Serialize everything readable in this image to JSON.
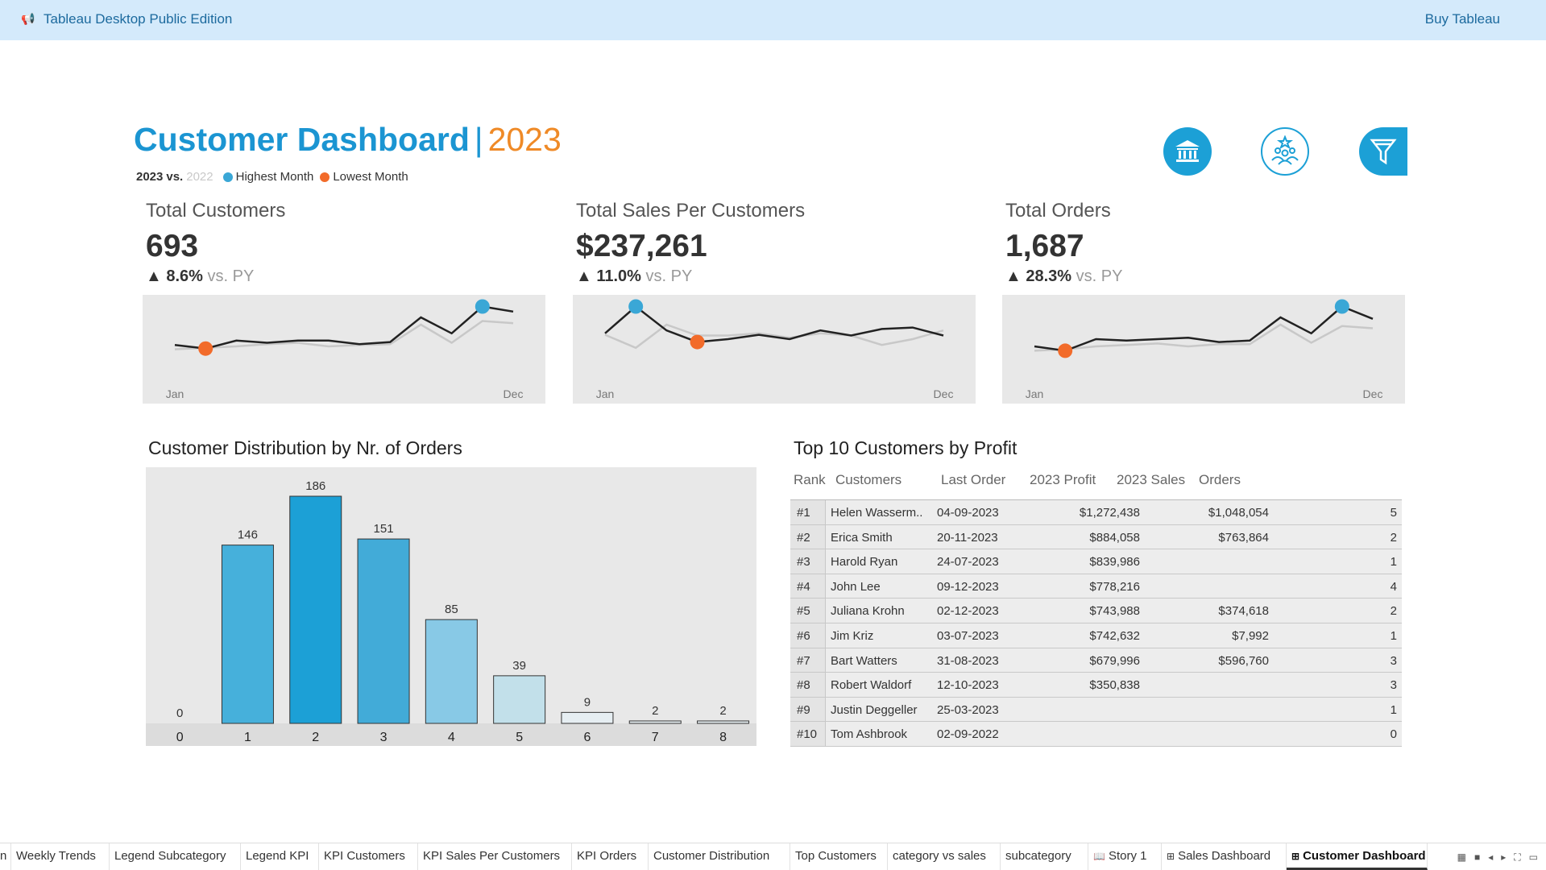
{
  "topbar": {
    "pin_icon": "megaphone-icon",
    "app_title": "Tableau Desktop Public Edition",
    "buy_label": "Buy Tableau"
  },
  "header": {
    "title": "Customer Dashboard",
    "separator": "|",
    "year": "2023",
    "legend": {
      "current": "2023",
      "vs": "vs.",
      "previous": "2022",
      "highest": "Highest Month",
      "lowest": "Lowest Month"
    }
  },
  "colors": {
    "accent": "#1b95d2",
    "year": "#ef8a27",
    "highest": "#3aa7d6",
    "lowest": "#f26b2a",
    "line_current": "#222222",
    "line_previous": "#c8c8c8"
  },
  "nav_icons": [
    {
      "name": "bank-icon"
    },
    {
      "name": "customers-icon"
    },
    {
      "name": "filter-icon"
    }
  ],
  "kpis": [
    {
      "label": "Total Customers",
      "value": "693",
      "delta": "8.6%",
      "vs": "vs. PY",
      "arrow": "▲",
      "start_label": "Jan",
      "end_label": "Dec",
      "current": [
        0.58,
        0.63,
        0.52,
        0.55,
        0.52,
        0.52,
        0.57,
        0.54,
        0.2,
        0.42,
        0.05,
        0.12
      ],
      "previous": [
        0.64,
        0.62,
        0.6,
        0.57,
        0.55,
        0.6,
        0.58,
        0.57,
        0.3,
        0.55,
        0.25,
        0.28
      ],
      "high_index": 10,
      "low_index": 1
    },
    {
      "label": "Total Sales Per Customers",
      "value": "$237,261",
      "delta": "11.0%",
      "vs": "vs. PY",
      "arrow": "▲",
      "start_label": "Jan",
      "end_label": "Dec",
      "current": [
        0.42,
        0.05,
        0.38,
        0.54,
        0.5,
        0.44,
        0.5,
        0.38,
        0.45,
        0.36,
        0.34,
        0.45
      ],
      "previous": [
        0.44,
        0.62,
        0.3,
        0.45,
        0.45,
        0.42,
        0.48,
        0.42,
        0.45,
        0.58,
        0.5,
        0.38
      ],
      "high_index": 1,
      "low_index": 3
    },
    {
      "label": "Total Orders",
      "value": "1,687",
      "delta": "28.3%",
      "vs": "vs. PY",
      "arrow": "▲",
      "start_label": "Jan",
      "end_label": "Dec",
      "current": [
        0.6,
        0.66,
        0.5,
        0.52,
        0.5,
        0.48,
        0.54,
        0.52,
        0.2,
        0.42,
        0.05,
        0.22
      ],
      "previous": [
        0.66,
        0.64,
        0.6,
        0.58,
        0.56,
        0.6,
        0.57,
        0.57,
        0.3,
        0.55,
        0.32,
        0.35
      ],
      "high_index": 10,
      "low_index": 1
    }
  ],
  "distribution": {
    "title": "Customer Distribution by Nr. of Orders"
  },
  "chart_data": {
    "type": "bar",
    "title": "Customer Distribution by Nr. of Orders",
    "categories": [
      "0",
      "1",
      "2",
      "3",
      "4",
      "5",
      "6",
      "7",
      "8"
    ],
    "values": [
      0,
      146,
      186,
      151,
      85,
      39,
      9,
      2,
      2
    ],
    "bar_colors": [
      "#1ca0d6",
      "#46b0db",
      "#1ca0d6",
      "#42abd8",
      "#88c9e6",
      "#c2e0ea",
      "#e6eef2",
      "#e6eef2",
      "#e6eef2"
    ],
    "xlabel": "",
    "ylabel": "",
    "ylim": [
      0,
      186
    ]
  },
  "top_customers": {
    "title": "Top 10 Customers by Profit",
    "headers": {
      "rank": "Rank",
      "customers": "Customers",
      "last_order": "Last Order",
      "profit": "2023 Profit",
      "sales": "2023 Sales",
      "orders": "Orders"
    },
    "rows": [
      {
        "rank": "#1",
        "customer": "Helen Wasserm..",
        "last": "04-09-2023",
        "profit": "$1,272,438",
        "sales": "$1,048,054",
        "orders": "5"
      },
      {
        "rank": "#2",
        "customer": "Erica Smith",
        "last": "20-11-2023",
        "profit": "$884,058",
        "sales": "$763,864",
        "orders": "2"
      },
      {
        "rank": "#3",
        "customer": "Harold Ryan",
        "last": "24-07-2023",
        "profit": "$839,986",
        "sales": "",
        "orders": "1"
      },
      {
        "rank": "#4",
        "customer": "John Lee",
        "last": "09-12-2023",
        "profit": "$778,216",
        "sales": "",
        "orders": "4"
      },
      {
        "rank": "#5",
        "customer": "Juliana Krohn",
        "last": "02-12-2023",
        "profit": "$743,988",
        "sales": "$374,618",
        "orders": "2"
      },
      {
        "rank": "#6",
        "customer": "Jim Kriz",
        "last": "03-07-2023",
        "profit": "$742,632",
        "sales": "$7,992",
        "orders": "1"
      },
      {
        "rank": "#7",
        "customer": "Bart Watters",
        "last": "31-08-2023",
        "profit": "$679,996",
        "sales": "$596,760",
        "orders": "3"
      },
      {
        "rank": "#8",
        "customer": "Robert Waldorf",
        "last": "12-10-2023",
        "profit": "$350,838",
        "sales": "",
        "orders": "3"
      },
      {
        "rank": "#9",
        "customer": "Justin Deggeller",
        "last": "25-03-2023",
        "profit": "",
        "sales": "",
        "orders": "1"
      },
      {
        "rank": "#10",
        "customer": "Tom Ashbrook",
        "last": "02-09-2022",
        "profit": "",
        "sales": "",
        "orders": "0"
      }
    ]
  },
  "tabs": [
    {
      "label": "n",
      "icon": ""
    },
    {
      "label": "Weekly Trends",
      "icon": ""
    },
    {
      "label": "Legend Subcategory",
      "icon": ""
    },
    {
      "label": "Legend KPI",
      "icon": ""
    },
    {
      "label": "KPI Customers",
      "icon": ""
    },
    {
      "label": "KPI Sales Per Customers",
      "icon": ""
    },
    {
      "label": "KPI Orders",
      "icon": ""
    },
    {
      "label": "Customer Distribution",
      "icon": ""
    },
    {
      "label": "Top Customers",
      "icon": ""
    },
    {
      "label": "category vs sales",
      "icon": ""
    },
    {
      "label": "subcategory",
      "icon": ""
    },
    {
      "label": "Story 1",
      "icon": "story-icon"
    },
    {
      "label": "Sales Dashboard",
      "icon": "dashboard-icon"
    },
    {
      "label": "Customer Dashboard",
      "icon": "dashboard-icon",
      "active": true
    }
  ],
  "tab_controls": [
    "grid-view-icon",
    "single-view-icon",
    "prev-icon",
    "next-icon",
    "fullscreen-icon",
    "presentation-icon"
  ]
}
